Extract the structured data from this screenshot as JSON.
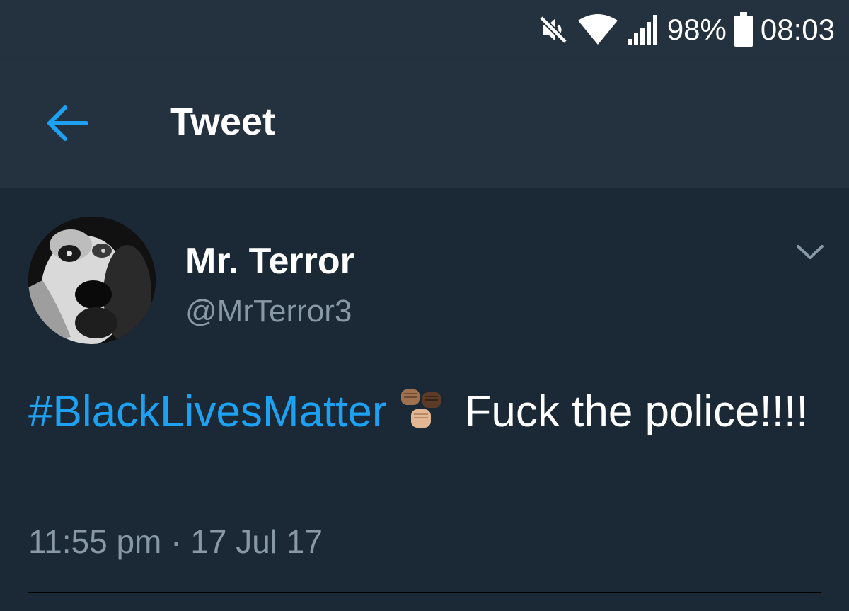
{
  "status_bar": {
    "battery_percent": "98%",
    "time": "08:03",
    "icons": [
      "mute-icon",
      "wifi-icon",
      "signal-icon",
      "battery-icon"
    ]
  },
  "header": {
    "title": "Tweet",
    "back_icon": "arrow-left-icon"
  },
  "tweet": {
    "display_name": "Mr. Terror",
    "handle": "@MrTerror3",
    "hashtag": "#BlackLivesMatter",
    "emoji": "raised-fists-emoji",
    "body_text": "Fuck the police!!!!",
    "timestamp": "11:55 pm · 17 Jul 17",
    "menu_icon": "chevron-down-icon"
  },
  "colors": {
    "background": "#1b2836",
    "header_background": "#24313f",
    "accent": "#1da1f2",
    "secondary_text": "#8899a6",
    "primary_text": "#ffffff"
  }
}
